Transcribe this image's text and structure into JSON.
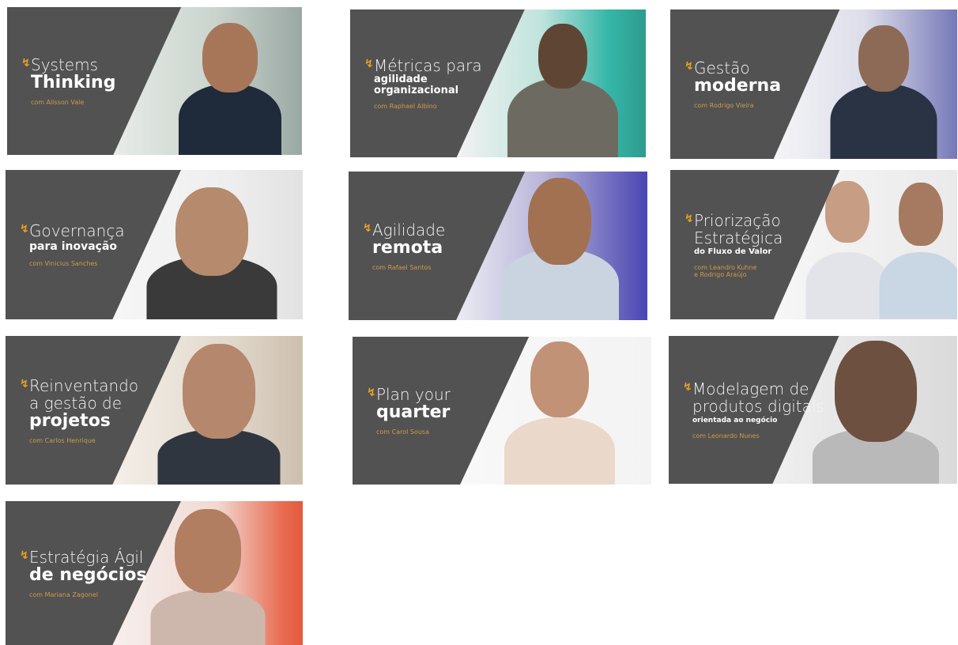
{
  "cards": [
    {
      "line1": "Systems",
      "line2": "Thinking",
      "author": "com Alisson Vale"
    },
    {
      "line1": "Métricas para",
      "line2": "agilidade\norganizacional",
      "author": "com Raphael Albino"
    },
    {
      "line1": "Gestão",
      "line2": "moderna",
      "author": "com Rodrigo Vieira"
    },
    {
      "line1": "Governança",
      "line2": "para inovação",
      "author": "com Vinicius Sanches"
    },
    {
      "line1": "Agilidade",
      "line2": "remota",
      "author": "com Rafael Santos"
    },
    {
      "line1": "Priorização\nEstratégica",
      "line2": "do Fluxo de Valor",
      "author": "com Leandro Kuhne\ne Rodrigo Araújo"
    },
    {
      "line1": "Reinventando\na gestão de",
      "line2": "projetos",
      "author": "com Carlos Henrique"
    },
    {
      "line1": "Plan your",
      "line2": "quarter",
      "author": "com Carol Sousa"
    },
    {
      "line1": "Modelagem de\nprodutos digitais",
      "line2": "orientada ao negócio",
      "author": "com Leonardo Nunes"
    },
    {
      "line1": "Estratégia Ágil",
      "line2": "de negócios",
      "author": "com Mariana Zagonel"
    }
  ]
}
